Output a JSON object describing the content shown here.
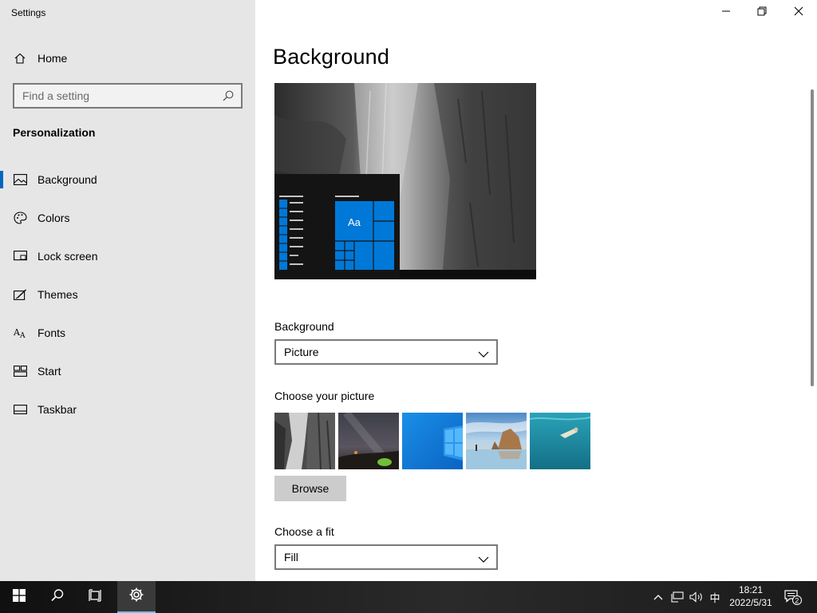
{
  "window": {
    "title": "Settings",
    "controls": {
      "minimize": "minimize",
      "restore": "restore",
      "close": "close"
    }
  },
  "sidebar": {
    "home_label": "Home",
    "search": {
      "placeholder": "Find a setting",
      "value": ""
    },
    "section_heading": "Personalization",
    "items": [
      {
        "label": "Background",
        "icon": "picture-icon",
        "active": true
      },
      {
        "label": "Colors",
        "icon": "palette-icon",
        "active": false
      },
      {
        "label": "Lock screen",
        "icon": "lock-screen-icon",
        "active": false
      },
      {
        "label": "Themes",
        "icon": "themes-icon",
        "active": false
      },
      {
        "label": "Fonts",
        "icon": "fonts-icon",
        "active": false
      },
      {
        "label": "Start",
        "icon": "start-icon",
        "active": false
      },
      {
        "label": "Taskbar",
        "icon": "taskbar-icon",
        "active": false
      }
    ]
  },
  "main": {
    "title": "Background",
    "preview": {
      "tile_label": "Aa"
    },
    "background_label": "Background",
    "background_value": "Picture",
    "choose_picture_label": "Choose your picture",
    "thumbnails": [
      "rock-cliff",
      "night-sky",
      "windows-logo",
      "beach-rocks",
      "underwater-swimmer"
    ],
    "browse_label": "Browse",
    "choose_fit_label": "Choose a fit",
    "fit_value": "Fill"
  },
  "taskbar": {
    "clock_time": "18:21",
    "clock_date": "2022/5/31",
    "ime_label": "中",
    "notification_count": "2"
  },
  "colors": {
    "accent": "#0078d7",
    "sidebar_bg": "#e6e6e6",
    "taskbar_bg": "#1a1a1a"
  }
}
